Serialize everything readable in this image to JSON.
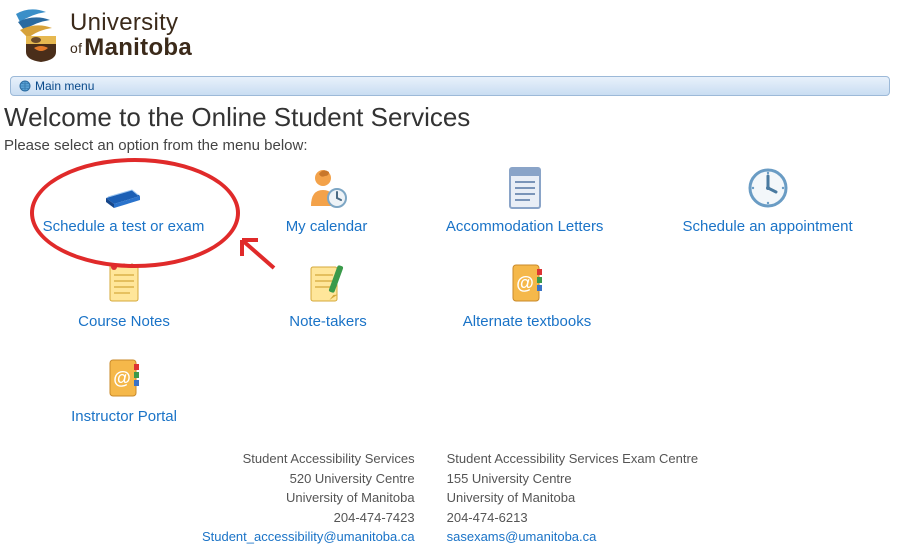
{
  "brand": {
    "line1": "University",
    "of": "of",
    "line2": "Manitoba"
  },
  "menubar": {
    "main_menu": "Main menu"
  },
  "page": {
    "title": "Welcome to the Online Student Services",
    "subtitle": "Please select an option from the menu below:"
  },
  "tiles": {
    "schedule_test": "Schedule a test or exam",
    "calendar": "My calendar",
    "accom_letters": "Accommodation Letters",
    "schedule_appt": "Schedule an appointment",
    "course_notes": "Course Notes",
    "note_takers": "Note-takers",
    "alt_textbooks": "Alternate textbooks",
    "instructor_portal": "Instructor Portal"
  },
  "footer": {
    "left": {
      "name": "Student Accessibility Services",
      "addr1": "520 University Centre",
      "addr2": "University of Manitoba",
      "phone": "204-474-7423",
      "email": "Student_accessibility@umanitoba.ca"
    },
    "right": {
      "name": "Student Accessibility Services Exam Centre",
      "addr1": "155 University Centre",
      "addr2": "University of Manitoba",
      "phone": "204-474-6213",
      "email": "sasexams@umanitoba.ca"
    }
  }
}
